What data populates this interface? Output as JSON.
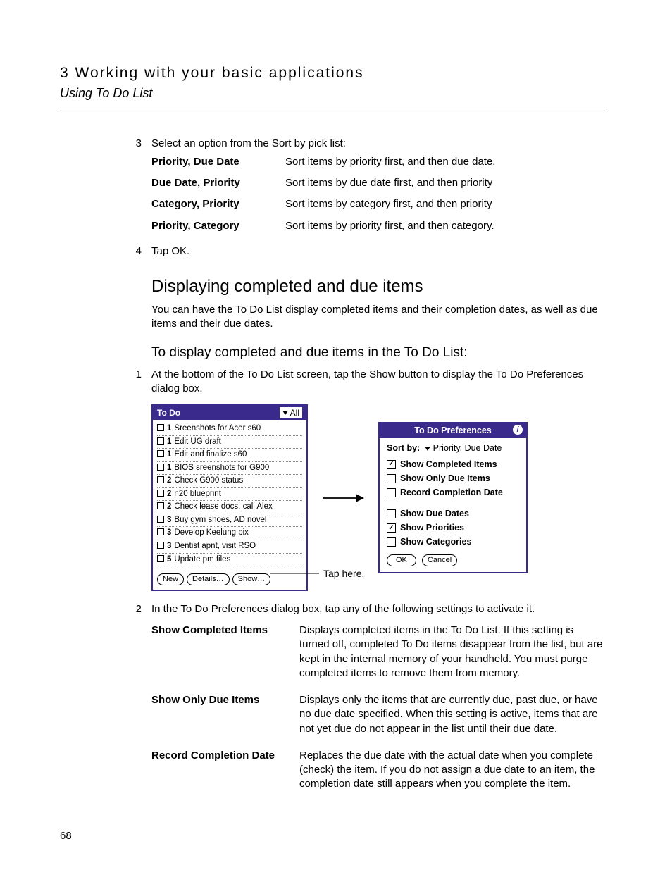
{
  "header": {
    "chapter": "3 Working with your basic applications",
    "section": "Using To Do List"
  },
  "step3": {
    "num": "3",
    "intro": "Select an option from the Sort by pick list:",
    "options": [
      {
        "term": "Priority, Due Date",
        "desc": "Sort items by priority first, and then due date."
      },
      {
        "term": "Due Date, Priority",
        "desc": "Sort items by due date first, and then priority"
      },
      {
        "term": "Category, Priority",
        "desc": "Sort items by category first, and then priority"
      },
      {
        "term": "Priority, Category",
        "desc": "Sort items by priority first, and then category."
      }
    ]
  },
  "step4": {
    "num": "4",
    "text": "Tap OK."
  },
  "heading2": "Displaying completed and due items",
  "para2": "You can have the To Do List display completed items and their completion dates, as well as due items and their due dates.",
  "heading3": "To display completed and due items in the To Do List:",
  "proc1": {
    "num": "1",
    "text": "At the bottom of the To Do List screen, tap the Show button to display the To Do Preferences dialog box."
  },
  "todo_screen": {
    "title": "To Do",
    "filter": "All",
    "items": [
      {
        "pri": "1",
        "text": "Sreenshots for Acer s60"
      },
      {
        "pri": "1",
        "text": "Edit UG draft"
      },
      {
        "pri": "1",
        "text": "Edit and finalize s60"
      },
      {
        "pri": "1",
        "text": "BIOS sreenshots for G900"
      },
      {
        "pri": "2",
        "text": "Check G900 status"
      },
      {
        "pri": "2",
        "text": "n20 blueprint"
      },
      {
        "pri": "2",
        "text": "Check lease docs, call Alex"
      },
      {
        "pri": "3",
        "text": "Buy gym shoes, AD novel"
      },
      {
        "pri": "3",
        "text": "Develop Keelung pix"
      },
      {
        "pri": "3",
        "text": "Dentist apnt, visit RSO"
      },
      {
        "pri": "5",
        "text": "Update pm files"
      }
    ],
    "buttons": {
      "new": "New",
      "details": "Details…",
      "show": "Show…"
    }
  },
  "tap_label": "Tap here.",
  "prefs_screen": {
    "title": "To Do Preferences",
    "sort_label": "Sort by:",
    "sort_value": "Priority, Due Date",
    "checks": [
      {
        "label": "Show Completed Items",
        "checked": true
      },
      {
        "label": "Show Only Due Items",
        "checked": false
      },
      {
        "label": "Record Completion Date",
        "checked": false
      }
    ],
    "checks2": [
      {
        "label": "Show Due Dates",
        "checked": false
      },
      {
        "label": "Show Priorities",
        "checked": true
      },
      {
        "label": "Show Categories",
        "checked": false
      }
    ],
    "ok": "OK",
    "cancel": "Cancel"
  },
  "proc2": {
    "num": "2",
    "intro": "In the To Do Preferences dialog box, tap any of the following settings to activate it.",
    "settings": [
      {
        "term": "Show Completed Items",
        "desc": "Displays completed items in the To Do List. If this setting is turned off, completed To Do items disappear from the list, but are kept in the internal memory of your handheld. You must purge completed items to remove them from memory."
      },
      {
        "term": "Show Only Due Items",
        "desc": "Displays only the items that are currently due, past due, or have no due date specified. When this setting is active, items that are not yet due do not appear in the list until their due date."
      },
      {
        "term": "Record Completion Date",
        "desc": "Replaces the due date with the actual date when you complete (check) the item. If you do not assign a due date to an item, the completion date still appears when you complete the item."
      }
    ]
  },
  "page_number": "68"
}
